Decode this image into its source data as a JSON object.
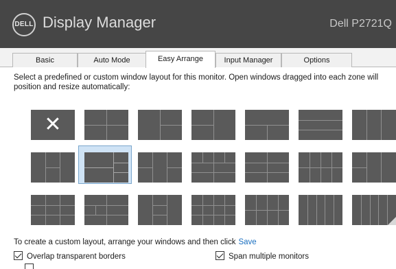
{
  "app": {
    "logo_text": "DELL",
    "title": "Display Manager",
    "monitor": "Dell P2721Q"
  },
  "tabs": [
    {
      "label": "Basic"
    },
    {
      "label": "Auto Mode"
    },
    {
      "label": "Easy Arrange",
      "active": true
    },
    {
      "label": "Input Manager"
    },
    {
      "label": "Options"
    }
  ],
  "easy_arrange": {
    "description": "Select a predefined or custom window layout for this monitor.  Open windows dragged into each zone will position and resize automatically:",
    "selected_layout_index": 8,
    "custom_text": "To create a custom layout, arrange your windows and then click",
    "save_label": "Save",
    "overlap_label": "Overlap transparent borders",
    "overlap_checked": true,
    "span_label": "Span multiple monitors",
    "span_checked": true
  },
  "icons": {
    "none_layout": "close-icon",
    "custom_slot": "corner-fold-icon"
  },
  "colors": {
    "titlebar": "#464646",
    "tile": "#5a5a5a",
    "zone_line": "#909090",
    "selection": "#cfe3f5",
    "link": "#1a6fc0"
  }
}
